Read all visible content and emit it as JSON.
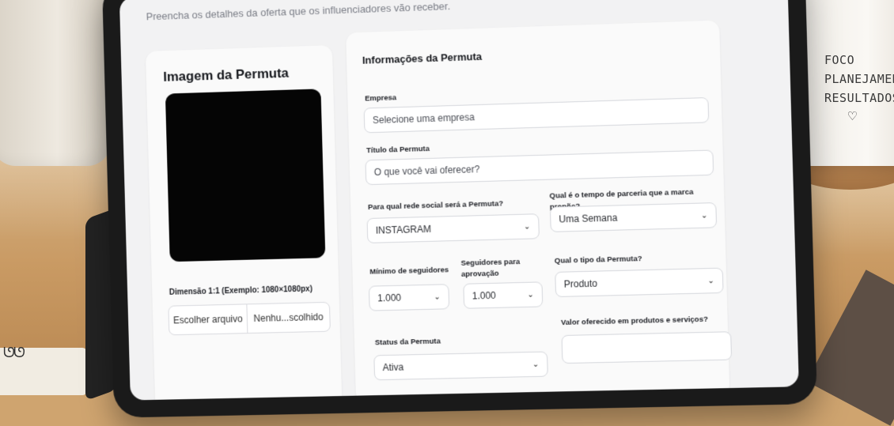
{
  "page": {
    "subtitle": "Preencha os detalhes da oferta que os influenciadores vão receber."
  },
  "image_card": {
    "title": "Imagem da Permuta",
    "dimension_hint": "Dimensão 1:1 (Exemplo: 1080×1080px)",
    "file_button": "Escolher arquivo",
    "file_status": "Nenhu...scolhido"
  },
  "info_card": {
    "title": "Informações da Permuta",
    "company": {
      "label": "Empresa",
      "placeholder": "Selecione uma empresa"
    },
    "title_field": {
      "label": "Título da Permuta",
      "placeholder": "O que você vai oferecer?"
    },
    "social_network": {
      "label": "Para qual rede social será a Permuta?",
      "value": "INSTAGRAM"
    },
    "partnership_time": {
      "label": "Qual é o tempo de parceria que a marca propõe?",
      "value": "Uma Semana"
    },
    "min_followers": {
      "label": "Mínimo de seguidores",
      "value": "1.000"
    },
    "approval_followers": {
      "label": "Seguidores para aprovação",
      "value": "1.000"
    },
    "barter_type": {
      "label": "Qual o tipo da Permuta?",
      "value": "Produto"
    },
    "status": {
      "label": "Status da Permuta",
      "value": "Ativa"
    },
    "offered_value": {
      "label": "Valor oferecido em produtos e serviços?",
      "value": ""
    }
  },
  "mug": {
    "lines": [
      "FOCO",
      "PLANEJAMENT",
      "RESULTADOS"
    ],
    "heart": "♡"
  },
  "icons": {
    "chevron": "⌄"
  }
}
